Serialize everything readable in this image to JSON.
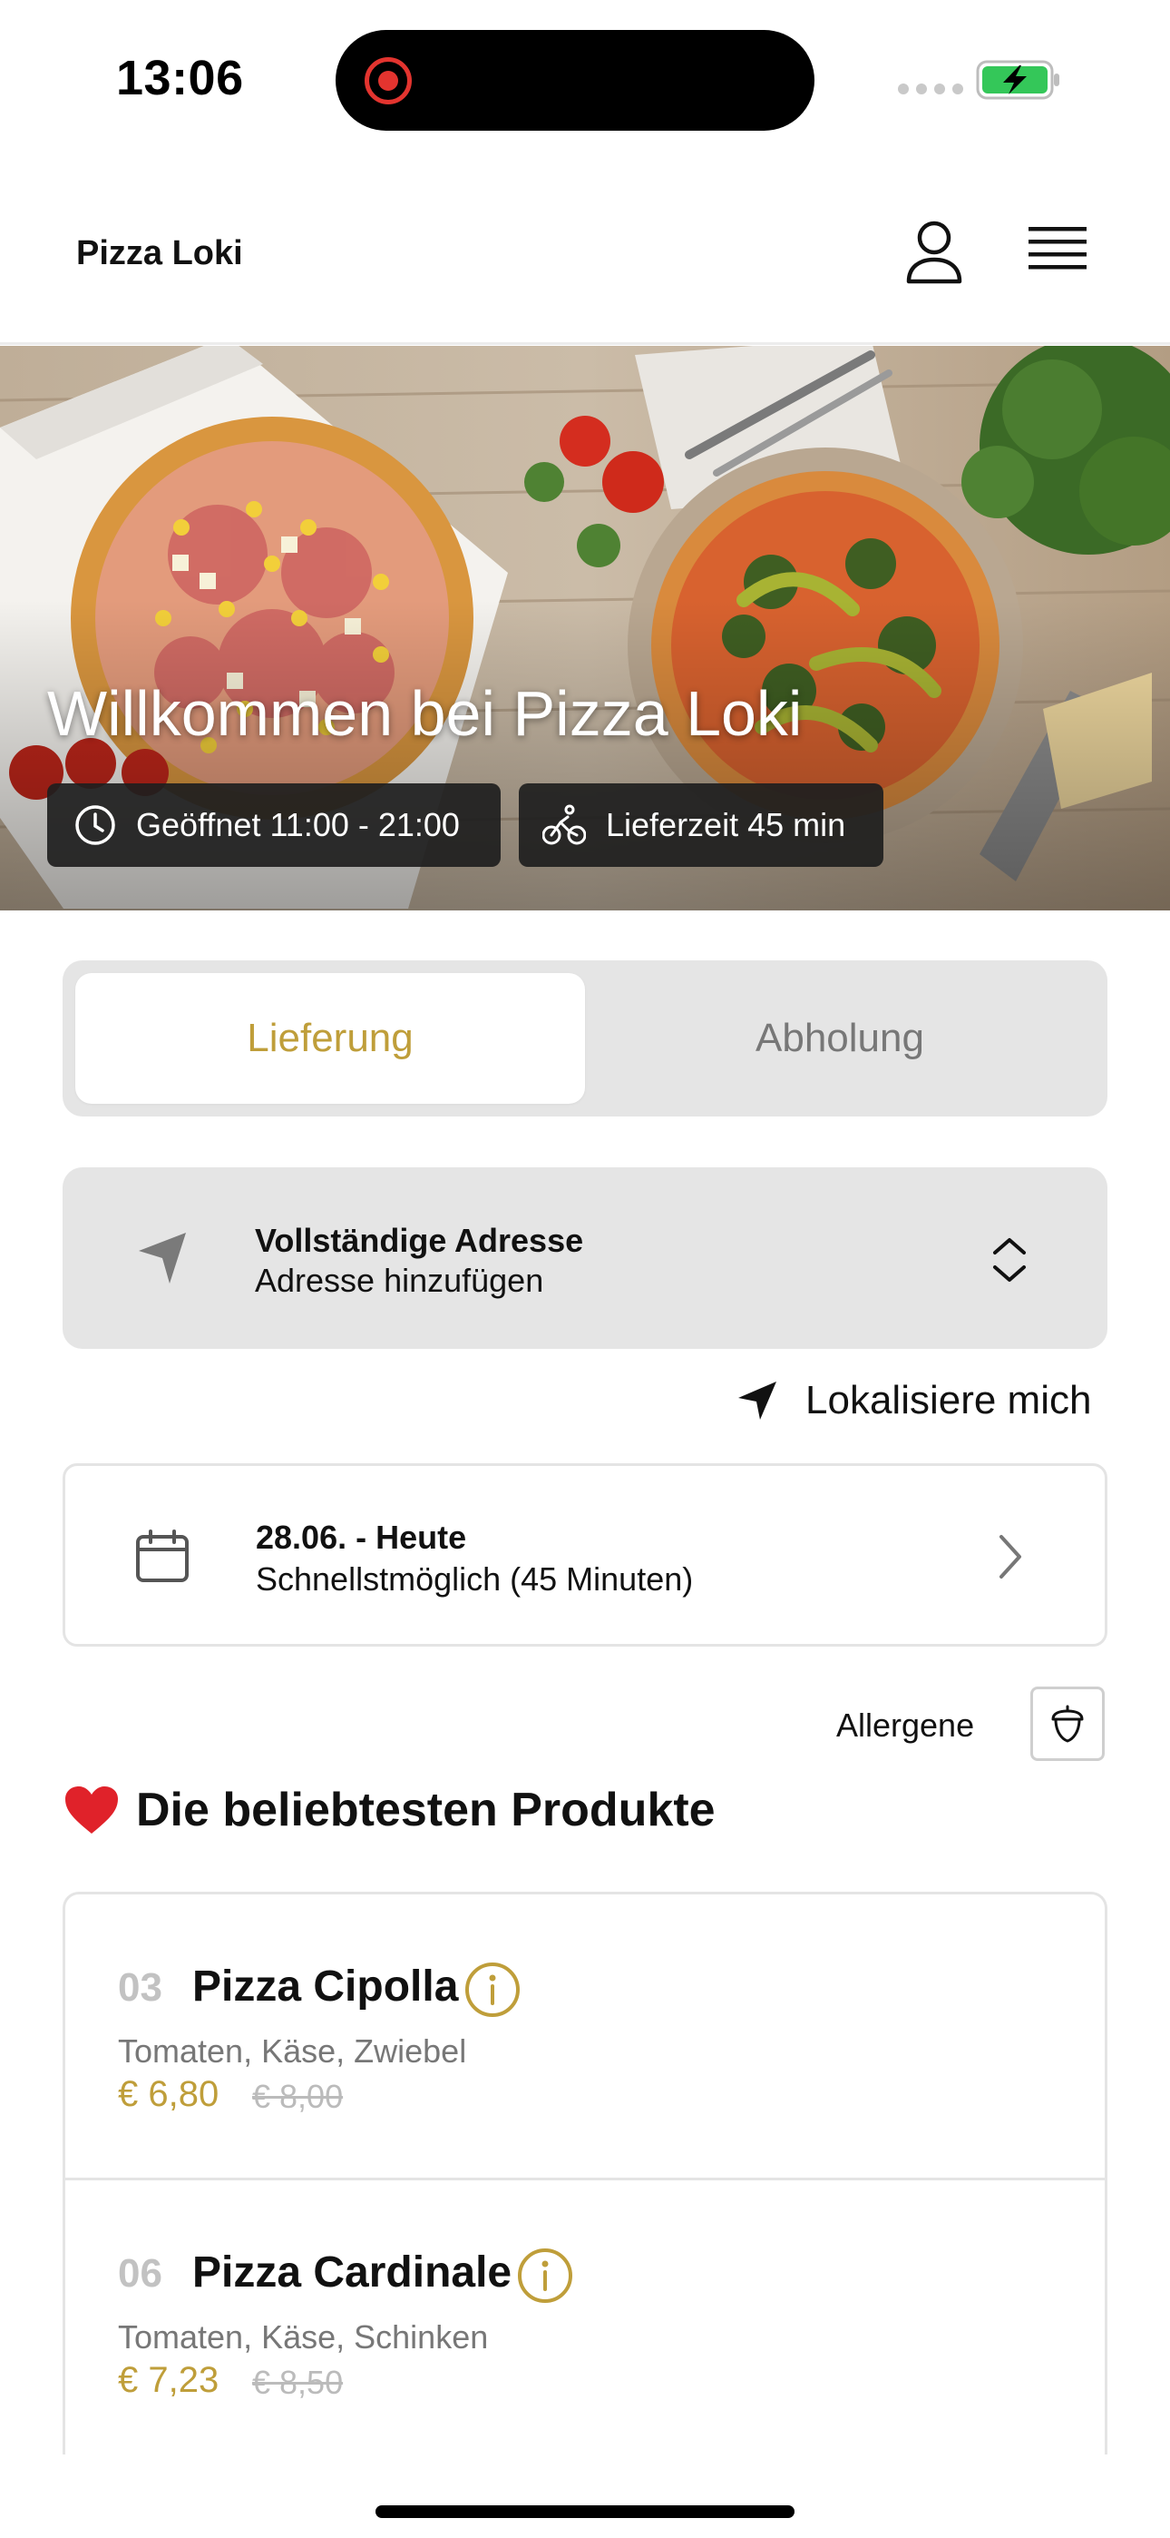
{
  "status_bar": {
    "time": "13:06"
  },
  "header": {
    "brand": "Pizza Loki"
  },
  "hero": {
    "title": "Willkommen bei Pizza Loki",
    "opening_hours": "Geöffnet 11:00 - 21:00",
    "delivery_time": "Lieferzeit 45 min"
  },
  "order_mode": {
    "tabs": [
      "Lieferung",
      "Abholung"
    ],
    "selected": "Lieferung"
  },
  "address": {
    "title": "Vollständige Adresse",
    "subtitle": "Adresse hinzufügen"
  },
  "locate": {
    "label": "Lokalisiere mich"
  },
  "date": {
    "title": "28.06. - Heute",
    "subtitle": "Schnellstmöglich (45 Minuten)"
  },
  "allergens": {
    "label": "Allergene"
  },
  "popular": {
    "emoji": "❤️",
    "title": "Die beliebtesten Produkte",
    "items": [
      {
        "number": "03",
        "name": "Pizza Cipolla",
        "description": "Tomaten, Käse, Zwiebel",
        "price": "€ 6,80",
        "old_price": "€ 8,00"
      },
      {
        "number": "06",
        "name": "Pizza Cardinale",
        "description": "Tomaten, Käse, Schinken",
        "price": "€ 7,23",
        "old_price": "€ 8,50"
      }
    ]
  },
  "colors": {
    "accent": "#bf9e3a",
    "panel": "#e5e5e5",
    "border": "#e4e4e4"
  },
  "icons": [
    "user-icon",
    "menu-icon",
    "clock-icon",
    "bicycle-icon",
    "navigation-arrow-icon",
    "chevron-up-down-icon",
    "location-arrow-icon",
    "calendar-icon",
    "chevron-right-icon",
    "acorn-icon",
    "heart-icon",
    "info-icon"
  ]
}
